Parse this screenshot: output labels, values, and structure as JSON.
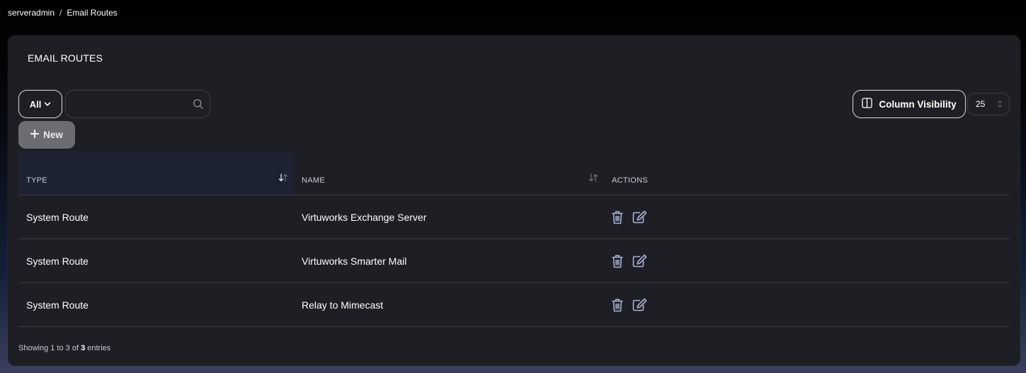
{
  "breadcrumb": {
    "parent": "serveradmin",
    "separator": "/",
    "current": "Email Routes"
  },
  "card": {
    "title": "EMAIL ROUTES"
  },
  "toolbar": {
    "filter_label": "All",
    "search_placeholder": "",
    "column_visibility_label": "Column Visibility",
    "page_size": "25",
    "new_label": "New"
  },
  "table": {
    "headers": {
      "type": "TYPE",
      "name": "NAME",
      "actions": "ACTIONS"
    },
    "rows": [
      {
        "type": "System Route",
        "name": "Virtuworks Exchange Server"
      },
      {
        "type": "System Route",
        "name": "Virtuworks Smarter Mail"
      },
      {
        "type": "System Route",
        "name": "Relay to Mimecast"
      }
    ]
  },
  "footer": {
    "prefix": "Showing 1 to 3 of",
    "total": "3",
    "suffix": "entries"
  },
  "icons": {
    "search": "search-icon",
    "chevron": "chevron-down-icon",
    "columns": "columns-icon",
    "plus": "plus-icon",
    "sort": "sort-icon",
    "delete": "trash-icon",
    "edit": "edit-icon",
    "select": "select-arrows-icon"
  },
  "colors": {
    "card_bg": "#1e1f25",
    "header_active_bg": "#1d2233",
    "icon": "#a9b2d4",
    "new_button_bg": "#6c6d72"
  }
}
